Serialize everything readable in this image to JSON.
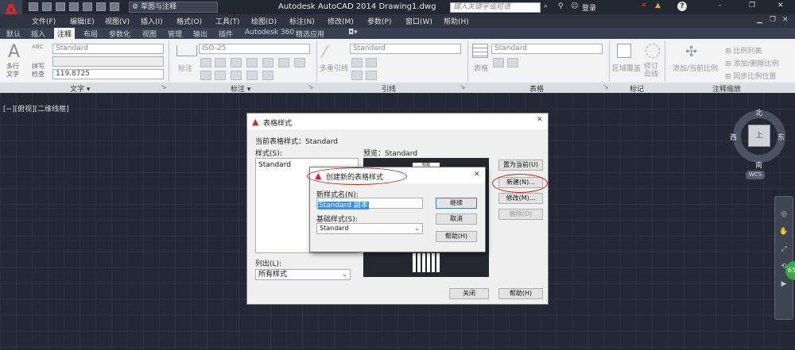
{
  "app": {
    "logo_letter": "A",
    "workspace": "草图与注释",
    "title": "Autodesk AutoCAD 2014    Drawing1.dwg",
    "search_placeholder": "键入关键字或短语",
    "login": "登录",
    "help_icon": "?",
    "window_controls": [
      "-",
      "❐",
      "✕"
    ]
  },
  "menu": [
    "文件(F)",
    "编辑(E)",
    "视图(V)",
    "插入(I)",
    "格式(O)",
    "工具(T)",
    "绘图(D)",
    "标注(N)",
    "修改(M)",
    "参数(P)",
    "窗口(W)",
    "帮助(H)"
  ],
  "tabs": [
    "默认",
    "插入",
    "注释",
    "布局",
    "参数化",
    "视图",
    "管理",
    "输出",
    "插件",
    "Autodesk 360",
    "精选应用"
  ],
  "active_tab": "注释",
  "ribbon": {
    "text": {
      "multiline": "多行\n文字",
      "spell": "拼写\n检查",
      "abc": "ABC",
      "style": "Standard",
      "height": "119.8725",
      "panel": "文字 ▾"
    },
    "dim": {
      "label": "标注",
      "style": "ISO-25",
      "panel": "标注 ▾"
    },
    "leader": {
      "label": "多重引线",
      "style": "Standard",
      "panel": "引线"
    },
    "table": {
      "label": "表格",
      "style": "Standard",
      "panel": "表格"
    },
    "markup": {
      "wipeout": "区域覆盖",
      "revcloud": "修订\n云线",
      "panel": "标记"
    },
    "scale": {
      "add": "添加/当前比例",
      "list": "比例列表",
      "addremove": "添加/删除比例",
      "sync": "同步比例位置",
      "panel": "注释缩放"
    }
  },
  "viewport_label": "[−][俯视][二维线框]",
  "viewcube": {
    "n": "北",
    "s": "南",
    "e": "东",
    "w": "西",
    "top": "上",
    "wcs": "WCS"
  },
  "badge": "65",
  "table_style_dialog": {
    "title": "表格样式",
    "current_label": "当前表格样式：Standard",
    "styles_label": "样式(S):",
    "styles": [
      "Standard"
    ],
    "preview_label": "预览：Standard",
    "preview_header": "标题",
    "list_label": "列出(L):",
    "list_value": "所有样式",
    "btn_set_current": "置为当前(U)",
    "btn_new": "新建(N)...",
    "btn_modify": "修改(M)...",
    "btn_delete": "删除(D)",
    "btn_close": "关闭",
    "btn_help": "帮助(H)",
    "close_x": "✕"
  },
  "new_style_dialog": {
    "title": "创建新的表格样式",
    "name_label": "新样式名(N):",
    "name_value": "Standard 副本",
    "base_label": "基础样式(S):",
    "base_value": "Standard",
    "btn_continue": "继续",
    "btn_cancel": "取消",
    "btn_help": "帮助(H)",
    "close_x": "✕"
  }
}
